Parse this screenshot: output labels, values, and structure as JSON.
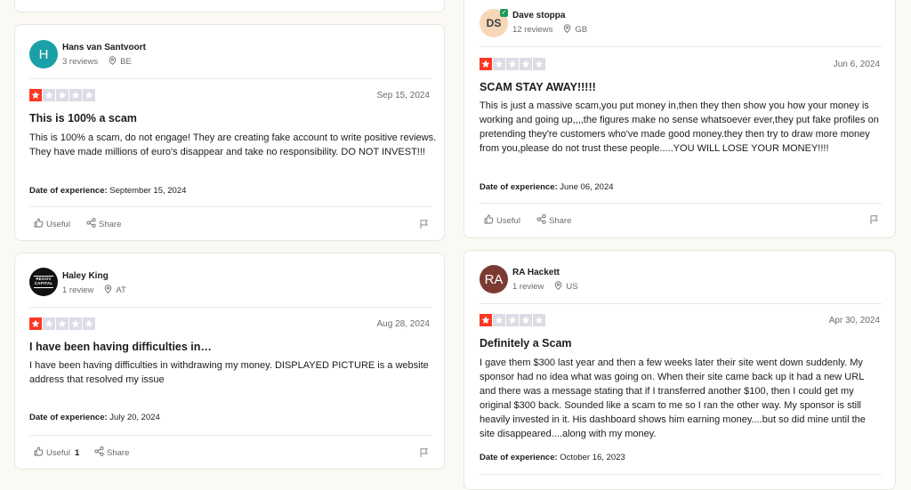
{
  "reviews": [
    {
      "avatar_text": "H",
      "name": "Hans van Santvoort",
      "count": "3 reviews",
      "country": "BE",
      "rating": 1,
      "date": "Sep 15, 2024",
      "title": "This is 100% a scam",
      "body": "This is 100% a scam, do not engage! They are creating fake account to write positive reviews. They have made millions of euro's disappear and take no responsibility. DO NOT INVEST!!!",
      "exp_label": "Date of experience:",
      "exp_date": "September 15, 2024",
      "useful": "Useful",
      "useful_count": "",
      "share": "Share"
    },
    {
      "avatar_text": "DS",
      "name": "Dave stoppa",
      "count": "12 reviews",
      "country": "GB",
      "rating": 1,
      "date": "Jun 6, 2024",
      "title": "SCAM STAY AWAY!!!!!",
      "body": "This is just a massive scam,you put money in,then they then show you how your money is working and going up,,,,the figures make no sense whatsoever ever,they put fake profiles on pretending they're customers who've made good money.they then try to draw more money from you,please do not trust these people.....YOU WILL LOSE YOUR MONEY!!!!",
      "exp_label": "Date of experience:",
      "exp_date": "June 06, 2024",
      "useful": "Useful",
      "useful_count": "",
      "share": "Share"
    },
    {
      "avatar_text": "REGOV CAPITAL",
      "name": "Haley King",
      "count": "1 review",
      "country": "AT",
      "rating": 1,
      "date": "Aug 28, 2024",
      "title": "I have been having difficulties in…",
      "body": "I have been having difficulties in withdrawing my money. DISPLAYED PICTURE is a website address that resolved my issue",
      "exp_label": "Date of experience:",
      "exp_date": "July 20, 2024",
      "useful": "Useful",
      "useful_count": "1",
      "share": "Share"
    },
    {
      "avatar_text": "RA",
      "name": "RA Hackett",
      "count": "1 review",
      "country": "US",
      "rating": 1,
      "date": "Apr 30, 2024",
      "title": "Definitely a Scam",
      "body": "I gave them $300 last year and then a few weeks later their site went down suddenly. My sponsor had no idea what was going on. When their site came back up it had a new URL and there was a message stating that if I transferred another $100, then I could get my original $300 back. Sounded like a scam to me so I ran the other way. My sponsor is still heavily invested in it. His dashboard shows him earning money....but so did mine until the site disappeared....along with my money.",
      "exp_label": "Date of experience:",
      "exp_date": "October 16, 2023",
      "useful": "Useful",
      "useful_count": "",
      "share": "Share"
    }
  ],
  "icons": {
    "star": "star-icon",
    "location": "location-pin-icon",
    "useful": "thumbs-up-icon",
    "share": "share-icon",
    "flag": "flag-icon",
    "verified": "verified-check-icon"
  },
  "colors": {
    "star_on": "#ff3722",
    "star_off": "#dcdce6",
    "background": "#fbf9f3",
    "verified": "#1d9b57"
  }
}
